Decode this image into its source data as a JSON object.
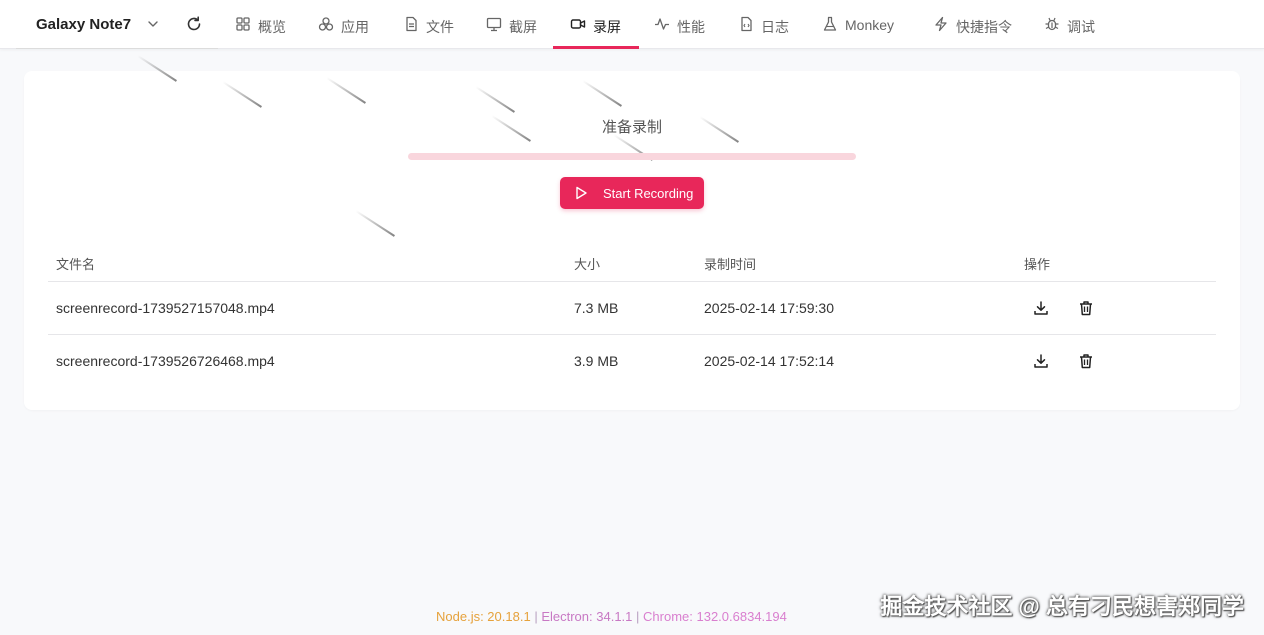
{
  "device": {
    "name": "Galaxy Note7"
  },
  "tabs": [
    {
      "label": "概览",
      "icon": "grid-icon"
    },
    {
      "label": "应用",
      "icon": "apps-icon"
    },
    {
      "label": "文件",
      "icon": "file-icon"
    },
    {
      "label": "截屏",
      "icon": "screenshot-icon"
    },
    {
      "label": "录屏",
      "icon": "video-icon",
      "active": true
    },
    {
      "label": "性能",
      "icon": "pulse-icon"
    },
    {
      "label": "日志",
      "icon": "log-icon"
    },
    {
      "label": "Monkey",
      "icon": "flask-icon"
    },
    {
      "label": "快捷指令",
      "icon": "lightning-icon"
    },
    {
      "label": "调试",
      "icon": "bug-icon"
    }
  ],
  "recorder": {
    "status": "准备录制",
    "progress": 0,
    "start_label": "Start Recording"
  },
  "table": {
    "headers": {
      "name": "文件名",
      "size": "大小",
      "time": "录制时间",
      "actions": "操作"
    },
    "rows": [
      {
        "name": "screenrecord-1739527157048.mp4",
        "size": "7.3 MB",
        "time": "2025-02-14 17:59:30"
      },
      {
        "name": "screenrecord-1739526726468.mp4",
        "size": "3.9 MB",
        "time": "2025-02-14 17:52:14"
      }
    ]
  },
  "footer": {
    "node": "Node.js: 20.18.1",
    "sep": "|",
    "electron": "Electron: 34.1.1",
    "chrome": "Chrome: 132.0.6834.194"
  },
  "watermark": "掘金技术社区 @ 总有刁民想害郑同学",
  "colors": {
    "accent": "#e8275a",
    "progress_track": "#f9d6dd",
    "footer_node": "#e6a23c",
    "footer_electron": "#c879c4",
    "footer_chrome": "#d97fcf"
  }
}
